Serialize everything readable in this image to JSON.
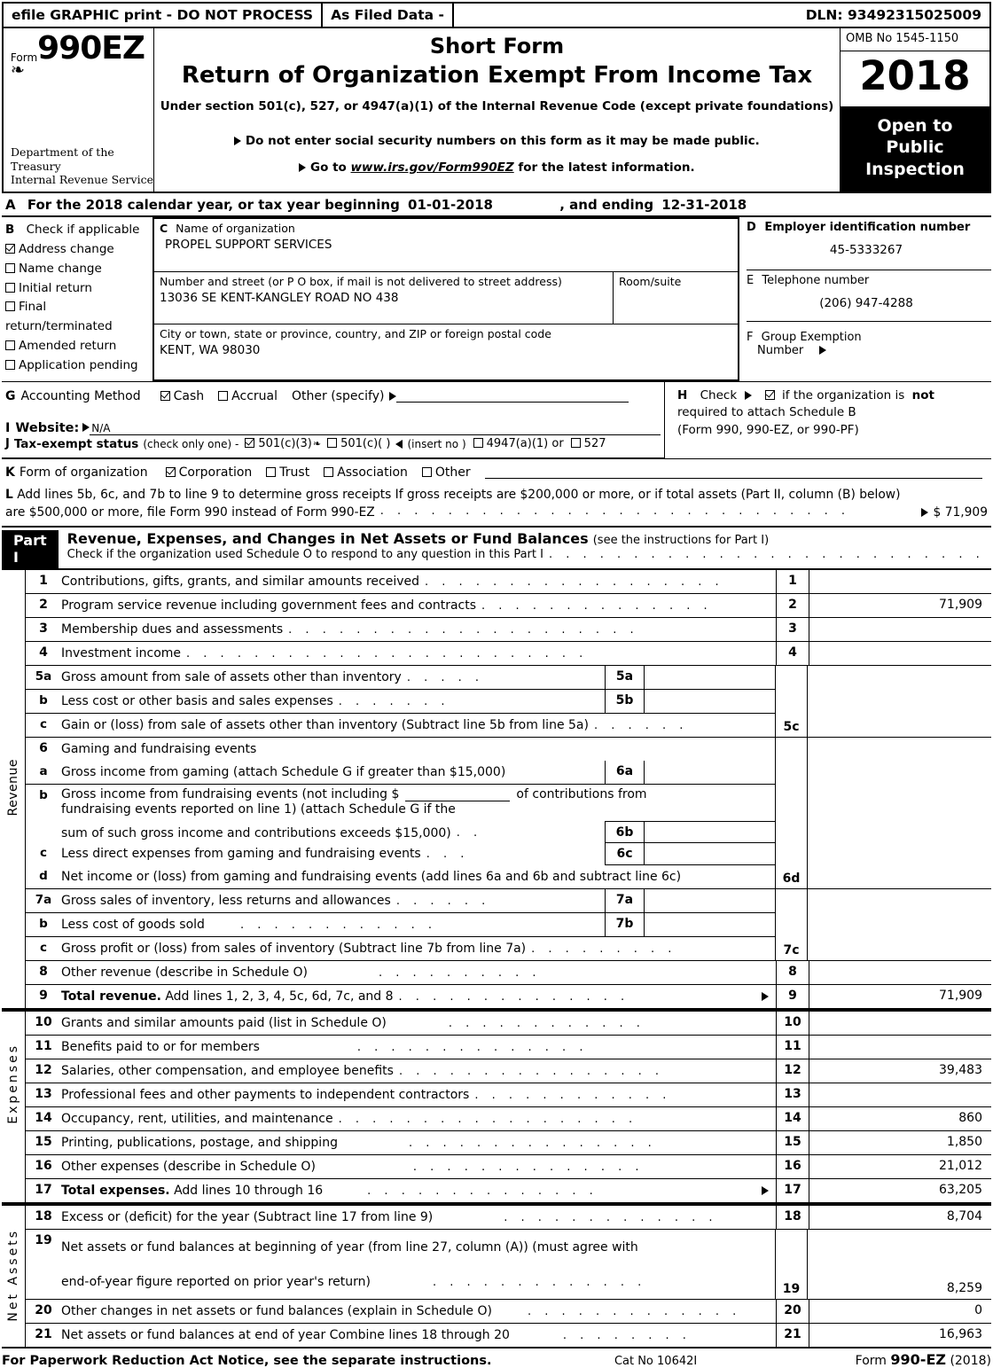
{
  "efile": {
    "graphic_print": "efile GRAPHIC print - DO NOT PROCESS",
    "as_filed": "As Filed Data -",
    "dln": "DLN: 93492315025009"
  },
  "masthead": {
    "form_label": "Form",
    "form_number": "990EZ",
    "irs_logo_glyph": "❧",
    "department": "Department of the\nTreasury\nInternal Revenue Service",
    "title_short": "Short Form",
    "title_main": "Return of Organization Exempt From Income Tax",
    "subtitle": "Under section 501(c), 527, or 4947(a)(1) of the Internal Revenue Code (except private foundations)",
    "note_ssn": "Do not enter social security numbers on this form as it may be made public.",
    "note_goto_prefix": "Go to",
    "note_goto_link": "www.irs.gov/Form990EZ",
    "note_goto_suffix": "for the latest information.",
    "omb": "OMB No  1545-1150",
    "year": "2018",
    "open_to_public": "Open to\nPublic\nInspection"
  },
  "section_a": {
    "letter": "A",
    "text_1": "For the 2018 calendar year, or tax year beginning",
    "begin_date": "01-01-2018",
    "text_2": ", and ending",
    "end_date": "12-31-2018"
  },
  "section_b": {
    "letter": "B",
    "header": "Check if applicable",
    "items": [
      {
        "label": "Address change",
        "checked": true
      },
      {
        "label": "Name change",
        "checked": false
      },
      {
        "label": "Initial return",
        "checked": false
      },
      {
        "label": "Final return/terminated",
        "checked": false
      },
      {
        "label": "Amended return",
        "checked": false
      },
      {
        "label": "Application pending",
        "checked": false
      }
    ]
  },
  "section_c": {
    "letter": "C",
    "name_label": "Name of organization",
    "name_value": "PROPEL SUPPORT SERVICES",
    "street_label": "Number and street (or P  O  box, if mail is not delivered to street address)",
    "street_value": "13036 SE KENT-KANGLEY ROAD NO 438",
    "room_label": "Room/suite",
    "room_value": "",
    "city_label": "City or town, state or province, country, and ZIP or foreign postal code",
    "city_value": "KENT, WA  98030"
  },
  "section_d": {
    "letter": "D",
    "ein_label": "Employer identification number",
    "ein_value": "45-5333267",
    "phone_letter": "E",
    "phone_label": "Telephone number",
    "phone_value": "(206) 947-4288",
    "group_letter": "F",
    "group_label_1": "Group Exemption",
    "group_label_2": "Number"
  },
  "section_g": {
    "letter": "G",
    "label": "Accounting Method",
    "cash": "Cash",
    "cash_checked": true,
    "accrual": "Accrual",
    "accrual_checked": false,
    "other": "Other (specify)"
  },
  "section_h": {
    "letter": "H",
    "check_label": "Check",
    "checked": true,
    "text_1": "if the organization is",
    "bold_not": "not",
    "text_2": "required to attach Schedule B",
    "text_3": "(Form 990, 990-EZ, or 990-PF)"
  },
  "section_i": {
    "letter": "I",
    "label": "Website:",
    "value": "N/A"
  },
  "section_j": {
    "letter": "J",
    "label": "Tax-exempt status",
    "note": "(check only one) -",
    "opt_501c3": "501(c)(3)",
    "opt_501c3_checked": true,
    "opt_501c": "501(c)(  )",
    "opt_501c_checked": false,
    "insert_no": "(insert no )",
    "opt_4947": "4947(a)(1) or",
    "opt_4947_checked": false,
    "opt_527": "527",
    "opt_527_checked": false
  },
  "section_k": {
    "letter": "K",
    "label": "Form of organization",
    "items": [
      {
        "label": "Corporation",
        "checked": true
      },
      {
        "label": "Trust",
        "checked": false
      },
      {
        "label": "Association",
        "checked": false
      },
      {
        "label": "Other",
        "checked": false
      }
    ]
  },
  "section_l": {
    "letter": "L",
    "line_1": "Add lines 5b, 6c, and 7b to line 9 to determine gross receipts  If gross receipts are $200,000 or more, or if total assets (Part II, column (B) below)",
    "line_2": "are $500,000 or more, file Form 990 instead of Form 990-EZ",
    "amount": "$ 71,909"
  },
  "part_i": {
    "tag": "Part I",
    "title": "Revenue, Expenses, and Changes in Net Assets or Fund Balances",
    "title_note": "(see the instructions for Part I)",
    "check_line": "Check if the organization used Schedule O to respond to any question in this Part I",
    "check_checked": true
  },
  "vertical_labels": {
    "revenue": "Revenue",
    "expenses": "Expenses",
    "net_assets": "Net Assets"
  },
  "lines": {
    "l1": {
      "num": "1",
      "text": "Contributions, gifts, grants, and similar amounts received",
      "amt_num": "1",
      "amount": ""
    },
    "l2": {
      "num": "2",
      "text": "Program service revenue including government fees and contracts",
      "amt_num": "2",
      "amount": "71,909"
    },
    "l3": {
      "num": "3",
      "text": "Membership dues and assessments",
      "amt_num": "3",
      "amount": ""
    },
    "l4": {
      "num": "4",
      "text": "Investment income",
      "amt_num": "4",
      "amount": ""
    },
    "l5a": {
      "num": "5a",
      "text": "Gross amount from sale of assets other than inventory",
      "sub_num": "5a",
      "sub_amount": ""
    },
    "l5b": {
      "num": "b",
      "text": "Less  cost or other basis and sales expenses",
      "sub_num": "5b",
      "sub_amount": ""
    },
    "l5c": {
      "num": "c",
      "text": "Gain or (loss) from sale of assets other than inventory (Subtract line 5b from line 5a)",
      "amt_num": "5c",
      "amount": ""
    },
    "l6": {
      "num": "6",
      "text": "Gaming and fundraising events"
    },
    "l6a": {
      "num": "a",
      "text": "Gross income from gaming (attach Schedule G if greater than $15,000)",
      "sub_num": "6a",
      "sub_amount": ""
    },
    "l6b": {
      "num": "b",
      "text_1": "Gross income from fundraising events (not including $",
      "text_2": "of contributions from",
      "text_3": "fundraising events reported on line 1) (attach Schedule G if the",
      "text_4": "sum of such gross income and contributions exceeds $15,000)",
      "blank_value": "",
      "sub_num": "6b",
      "sub_amount": ""
    },
    "l6c": {
      "num": "c",
      "text": "Less  direct expenses from gaming and fundraising events",
      "sub_num": "6c",
      "sub_amount": ""
    },
    "l6d": {
      "num": "d",
      "text": "Net income or (loss) from gaming and fundraising events (add lines 6a and 6b and subtract line 6c)",
      "amt_num": "6d",
      "amount": ""
    },
    "l7a": {
      "num": "7a",
      "text": "Gross sales of inventory, less returns and allowances",
      "sub_num": "7a",
      "sub_amount": ""
    },
    "l7b": {
      "num": "b",
      "text": "Less  cost of goods sold",
      "sub_num": "7b",
      "sub_amount": ""
    },
    "l7c": {
      "num": "c",
      "text": "Gross profit or (loss) from sales of inventory (Subtract line 7b from line 7a)",
      "amt_num": "7c",
      "amount": ""
    },
    "l8": {
      "num": "8",
      "text": "Other revenue (describe in Schedule O)",
      "amt_num": "8",
      "amount": ""
    },
    "l9": {
      "num": "9",
      "text_bold": "Total revenue.",
      "text": "Add lines 1, 2, 3, 4, 5c, 6d, 7c, and 8",
      "amt_num": "9",
      "amount": "71,909"
    },
    "l10": {
      "num": "10",
      "text": "Grants and similar amounts paid (list in Schedule O)",
      "amt_num": "10",
      "amount": ""
    },
    "l11": {
      "num": "11",
      "text": "Benefits paid to or for members",
      "amt_num": "11",
      "amount": ""
    },
    "l12": {
      "num": "12",
      "text": "Salaries, other compensation, and employee benefits",
      "amt_num": "12",
      "amount": "39,483"
    },
    "l13": {
      "num": "13",
      "text": "Professional fees and other payments to independent contractors",
      "amt_num": "13",
      "amount": ""
    },
    "l14": {
      "num": "14",
      "text": "Occupancy, rent, utilities, and maintenance",
      "amt_num": "14",
      "amount": "860"
    },
    "l15": {
      "num": "15",
      "text": "Printing, publications, postage, and shipping",
      "amt_num": "15",
      "amount": "1,850"
    },
    "l16": {
      "num": "16",
      "text": "Other expenses (describe in Schedule O)",
      "amt_num": "16",
      "amount": "21,012"
    },
    "l17": {
      "num": "17",
      "text_bold": "Total expenses.",
      "text": "Add lines 10 through 16",
      "amt_num": "17",
      "amount": "63,205"
    },
    "l18": {
      "num": "18",
      "text": "Excess or (deficit) for the year (Subtract line 17 from line 9)",
      "amt_num": "18",
      "amount": "8,704"
    },
    "l19": {
      "num": "19",
      "text_1": "Net assets or fund balances at beginning of year (from line 27, column (A)) (must agree with",
      "text_2": "end-of-year figure reported on prior year's return)",
      "amt_num": "19",
      "amount": "8,259"
    },
    "l20": {
      "num": "20",
      "text": "Other changes in net assets or fund balances (explain in Schedule O)",
      "amt_num": "20",
      "amount": "0"
    },
    "l21": {
      "num": "21",
      "text": "Net assets or fund balances at end of year  Combine lines 18 through 20",
      "amt_num": "21",
      "amount": "16,963"
    }
  },
  "footer": {
    "notice": "For Paperwork Reduction Act Notice, see the separate instructions.",
    "cat_no": "Cat  No  10642I",
    "form_prefix": "Form",
    "form_bold": "990-EZ",
    "form_year": "(2018)"
  }
}
